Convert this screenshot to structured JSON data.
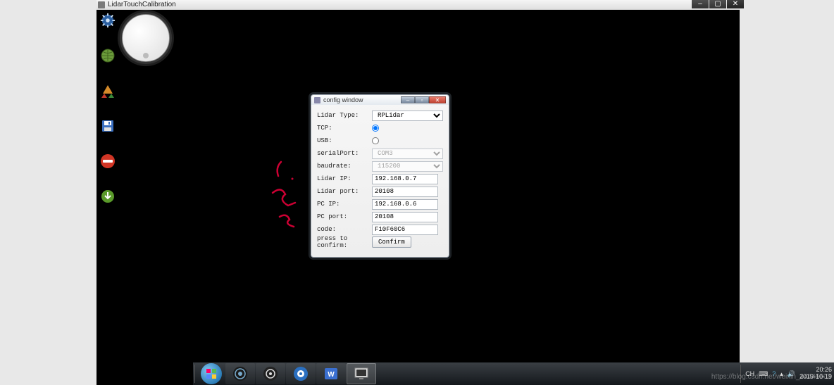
{
  "main_window": {
    "title": "LidarTouchCalibration",
    "min_label": "–",
    "max_label": "▢",
    "close_label": "✕"
  },
  "dock": [
    {
      "name": "gear-icon"
    },
    {
      "name": "globe-icon"
    },
    {
      "name": "apps-icon"
    },
    {
      "name": "save-icon"
    },
    {
      "name": "no-entry-icon"
    },
    {
      "name": "download-icon"
    }
  ],
  "dialog": {
    "title": "config window",
    "rows": {
      "lidar_type_label": "Lidar Type:",
      "tcp_label": "TCP:",
      "usb_label": "USB:",
      "serial_port_label": "serialPort:",
      "baudrate_label": "baudrate:",
      "lidar_ip_label": "Lidar IP:",
      "lidar_port_label": "Lidar port:",
      "pc_ip_label": "PC IP:",
      "pc_port_label": "PC port:",
      "code_label": "code:",
      "confirm_hint": "press to confirm:"
    },
    "values": {
      "lidar_type": "RPLidar",
      "serial_port": "COM3",
      "baudrate": "115200",
      "lidar_ip": "192.168.0.7",
      "lidar_port": "20108",
      "pc_ip": "192.168.0.6",
      "pc_port": "20108",
      "code": "F10F60C6"
    },
    "confirm_label": "Confirm"
  },
  "taskbar": {
    "items": [
      {
        "name": "browser-icon"
      },
      {
        "name": "obs-icon"
      },
      {
        "name": "app-blue-icon"
      },
      {
        "name": "wps-icon"
      },
      {
        "name": "monitor-icon"
      }
    ],
    "tray_lang": "CH",
    "tray_keyboard": "⌨",
    "tray_help": "?",
    "tray_up": "▴",
    "clock_time": "20:26",
    "clock_date": "2019-10-19"
  },
  "watermark": "https://blog.csdn.net/weixin_44446603",
  "annotations": [
    "1",
    "2",
    "3"
  ]
}
